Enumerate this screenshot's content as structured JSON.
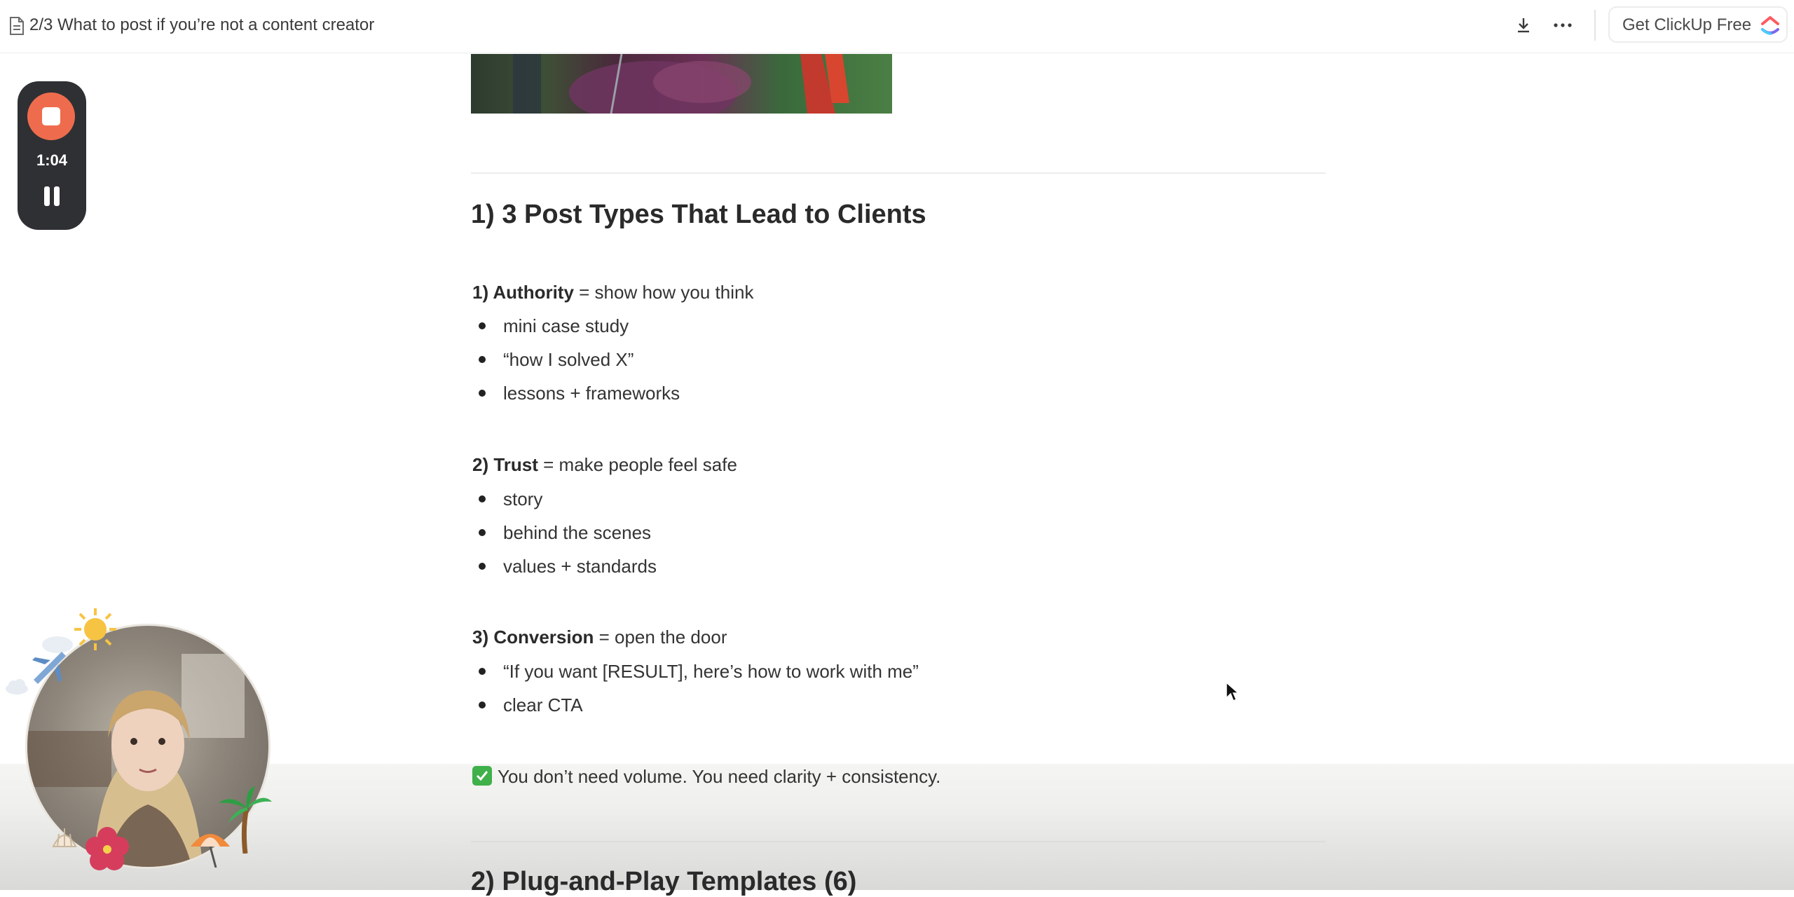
{
  "topbar": {
    "doc_icon": "document-icon",
    "title": "2/3 What to post if you’re not a content creator",
    "download_icon": "download-icon",
    "more_icon": "more-horizontal-icon",
    "cta_label": "Get ClickUp Free",
    "cta_logo": "clickup-logo"
  },
  "recorder": {
    "stop_icon": "stop-icon",
    "time": "1:04",
    "pause_icon": "pause-icon"
  },
  "content": {
    "heading1": "1) 3 Post Types That Lead to Clients",
    "sections": [
      {
        "label": "1) Authority",
        "desc": " = show how you think",
        "bullets": [
          "mini case study",
          "“how I solved X”",
          "lessons + frameworks"
        ]
      },
      {
        "label": "2) Trust",
        "desc": " = make people feel safe",
        "bullets": [
          "story",
          "behind the scenes",
          "values + standards"
        ]
      },
      {
        "label": "3) Conversion",
        "desc": " = open the door",
        "bullets": [
          "“If you want [RESULT], here’s how to work with me”",
          "clear CTA"
        ]
      }
    ],
    "callout_icon": "check-mark-icon",
    "callout": "You don’t need volume. You need clarity + consistency.",
    "heading2": "2) Plug-and-Play Templates (6)"
  },
  "colors": {
    "accent_record": "#ee6c4d",
    "recorder_bg": "#2f3033",
    "check_green": "#3fb04a"
  }
}
